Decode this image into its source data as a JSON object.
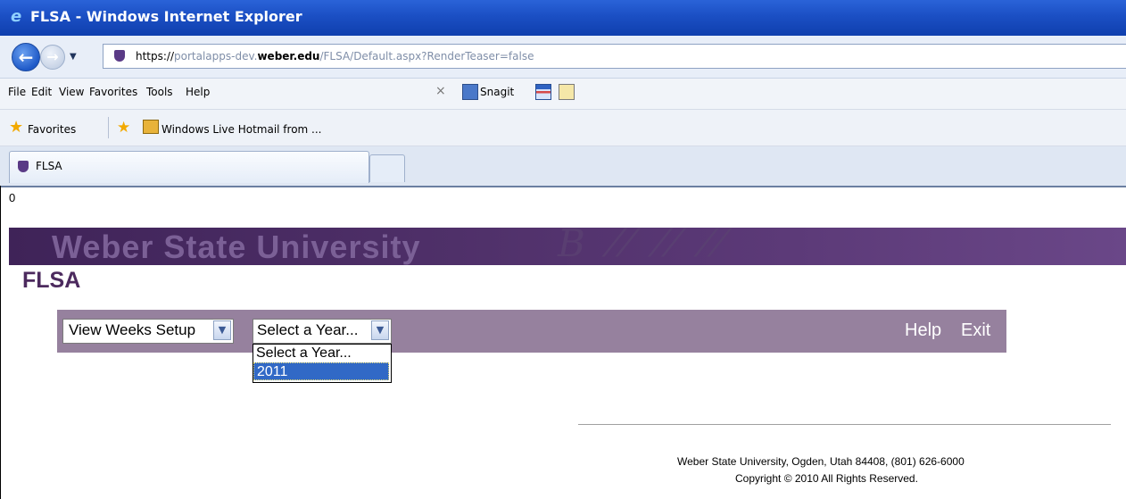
{
  "window": {
    "title": "FLSA - Windows Internet Explorer"
  },
  "address": {
    "scheme": "https://",
    "host_prefix": "portalapps-dev.",
    "host_domain": "weber.edu",
    "path": "/FLSA/Default.aspx?RenderTeaser=false"
  },
  "menu": {
    "file": "File",
    "edit": "Edit",
    "view": "View",
    "favorites": "Favorites",
    "tools": "Tools",
    "help": "Help"
  },
  "toolbar": {
    "close": "×",
    "snagit": "Snagit"
  },
  "favorites_bar": {
    "label": "Favorites",
    "hotmail": "Windows Live Hotmail from ..."
  },
  "tabs": [
    {
      "label": "FLSA"
    }
  ],
  "page": {
    "debug_value": "0",
    "banner": "Weber State University",
    "title": "FLSA",
    "view_select": {
      "value": "View Weeks Setup"
    },
    "year_select": {
      "value": "Select a Year...",
      "options": [
        "Select a Year...",
        "2011"
      ],
      "highlighted": "2011"
    },
    "links": {
      "help": "Help",
      "exit": "Exit"
    },
    "footer": {
      "line1": "Weber State University, Ogden, Utah 84408, (801) 626-6000",
      "line2": "Copyright © 2010 All Rights Reserved."
    }
  },
  "colors": {
    "titlebar": "#1b4fc4",
    "banner": "#4f3069",
    "control_bar": "#96819e",
    "page_title": "#4c2a5e",
    "highlight": "#3169c6"
  }
}
